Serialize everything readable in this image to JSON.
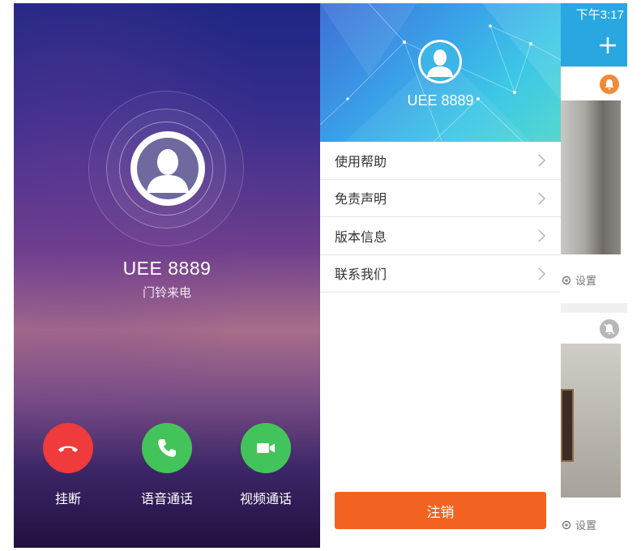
{
  "call": {
    "caller_name": "UEE 8889",
    "caller_subtitle": "门铃来电",
    "buttons": {
      "hangup": "挂断",
      "voice": "语音通话",
      "video": "视频通话"
    },
    "colors": {
      "hangup": "#ef3b3b",
      "answer": "#43c45a"
    }
  },
  "menu": {
    "username": "UEE 8889",
    "items": [
      {
        "label": "使用帮助"
      },
      {
        "label": "免责声明"
      },
      {
        "label": "版本信息"
      },
      {
        "label": "联系我们"
      }
    ],
    "logout_label": "注销",
    "colors": {
      "logout": "#f26322",
      "header": "#3aa0e8"
    }
  },
  "device_list": {
    "status_time": "下午3:17",
    "add_icon": "plus-icon",
    "cards": [
      {
        "bell_icon": "bell-icon",
        "settings_label": "设置"
      },
      {
        "bell_icon": "bell-off-icon",
        "settings_label": "设置"
      }
    ]
  }
}
